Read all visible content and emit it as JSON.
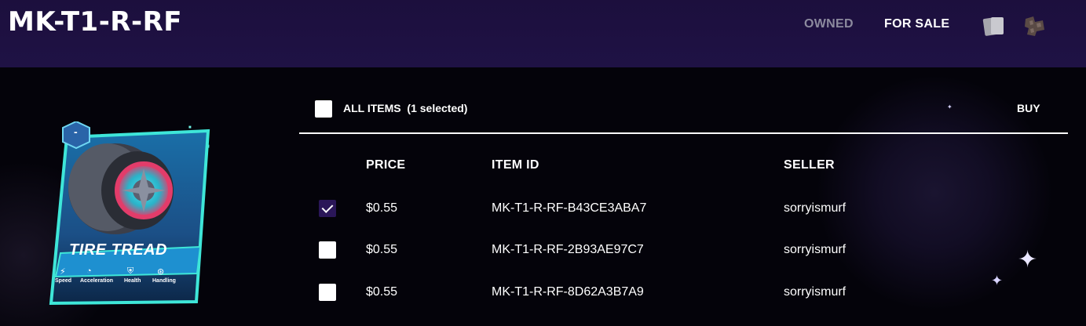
{
  "header": {
    "title": "MK-T1-R-RF",
    "tabs": [
      {
        "label": "OWNED",
        "active": false
      },
      {
        "label": "FOR SALE",
        "active": true
      }
    ],
    "icons": [
      "cards-icon",
      "tile-icon"
    ]
  },
  "card": {
    "name": "TIRE TREAD",
    "badge": "-",
    "stats": [
      {
        "label": "Speed",
        "icon": "lightning-icon"
      },
      {
        "label": "Acceleration",
        "icon": "speedometer-icon"
      },
      {
        "label": "Health",
        "icon": "shield-plus-icon"
      },
      {
        "label": "Handling",
        "icon": "steering-wheel-icon"
      }
    ]
  },
  "listing": {
    "select_all_label": "ALL ITEMS  (1 selected)",
    "buy_label": "BUY",
    "columns": {
      "price": "PRICE",
      "item_id": "ITEM ID",
      "seller": "SELLER"
    },
    "rows": [
      {
        "checked": true,
        "price": "$0.55",
        "item_id": "MK-T1-R-RF-B43CE3ABA7",
        "seller": "sorryismurf"
      },
      {
        "checked": false,
        "price": "$0.55",
        "item_id": "MK-T1-R-RF-2B93AE97C7",
        "seller": "sorryismurf"
      },
      {
        "checked": false,
        "price": "$0.55",
        "item_id": "MK-T1-R-RF-8D62A3B7A9",
        "seller": "sorryismurf"
      }
    ]
  },
  "colors": {
    "header_bg": "#1f1245",
    "accent": "#2a1658",
    "card_border": "#3ee6d8"
  }
}
